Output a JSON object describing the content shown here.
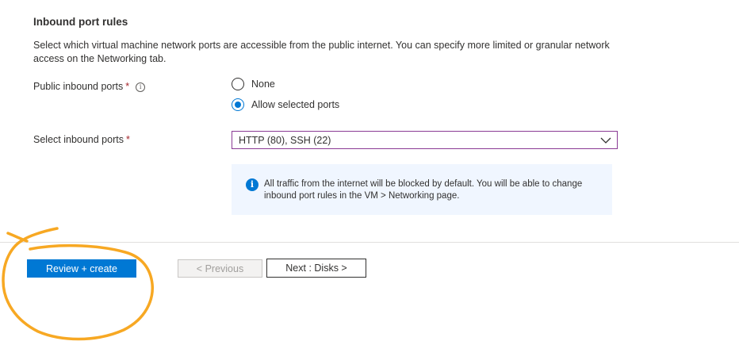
{
  "section": {
    "title": "Inbound port rules",
    "description": "Select which virtual machine network ports are accessible from the public internet. You can specify more limited or granular network access on the Networking tab."
  },
  "public_inbound_ports": {
    "label": "Public inbound ports",
    "required_mark": "*",
    "info_glyph": "i",
    "options": [
      {
        "label": "None",
        "selected": false
      },
      {
        "label": "Allow selected ports",
        "selected": true
      }
    ]
  },
  "select_inbound_ports": {
    "label": "Select inbound ports",
    "required_mark": "*",
    "value": "HTTP (80), SSH (22)",
    "icon": "chevron-down-icon"
  },
  "info_box": {
    "icon": "info-icon",
    "icon_glyph": "i",
    "text": "All traffic from the internet will be blocked by default. You will be able to change inbound port rules in the VM > Networking page."
  },
  "footer": {
    "review_create_label": "Review + create",
    "previous_label": "< Previous",
    "next_label": "Next : Disks >"
  },
  "colors": {
    "accent": "#0078d4",
    "required": "#a4262c",
    "dropdown_border": "#8a3a94",
    "info_background": "#f0f6ff",
    "annotation": "#f7a823"
  }
}
